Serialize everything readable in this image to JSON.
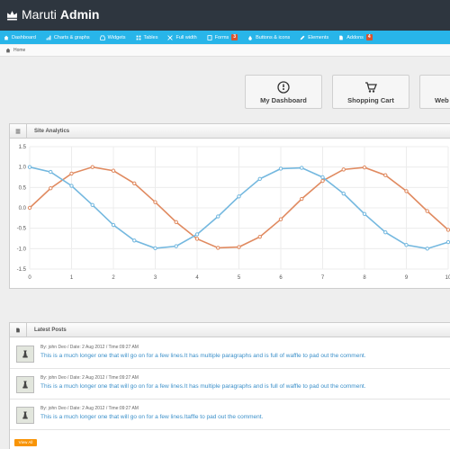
{
  "header": {
    "brand_light": "Maruti",
    "brand_bold": "Admin"
  },
  "nav": [
    {
      "label": "Dashboard",
      "icon": "home-icon"
    },
    {
      "label": "Charts & graphs",
      "icon": "signal-icon"
    },
    {
      "label": "Widgets",
      "icon": "inbox-icon"
    },
    {
      "label": "Tables",
      "icon": "th-icon"
    },
    {
      "label": "Full width",
      "icon": "fullscreen-icon"
    },
    {
      "label": "Forms",
      "icon": "forms-icon",
      "badge": "3"
    },
    {
      "label": "Buttons & icons",
      "icon": "tint-icon"
    },
    {
      "label": "Elements",
      "icon": "pencil-icon"
    },
    {
      "label": "Addons",
      "icon": "file-icon",
      "badge": "4"
    }
  ],
  "breadcrumb": {
    "home": "Home"
  },
  "quick_actions": [
    {
      "label": "My Dashboard",
      "icon": "dashboard-icon"
    },
    {
      "label": "Shopping Cart",
      "icon": "cart-icon"
    },
    {
      "label": "Web",
      "icon": "web-icon"
    }
  ],
  "analytics": {
    "title": "Site Analytics",
    "chart_data": {
      "type": "line",
      "xlim": [
        0,
        10
      ],
      "ylim": [
        -1.5,
        1.5
      ],
      "x_ticks": [
        "0",
        "1",
        "2",
        "3",
        "4",
        "5",
        "6",
        "7",
        "8",
        "9",
        "10"
      ],
      "y_ticks": [
        "1.5",
        "1.0",
        "0.5",
        "0.0",
        "-0.5",
        "-1.0",
        "-1.5"
      ],
      "grid": true,
      "x": [
        0,
        0.5,
        1,
        1.5,
        2,
        2.5,
        3,
        3.5,
        4,
        4.5,
        5,
        5.5,
        6,
        6.5,
        7,
        7.5,
        8,
        8.5,
        9,
        9.5,
        10
      ],
      "series": [
        {
          "color": "#e08a60",
          "values": [
            0.0,
            0.48,
            0.84,
            1.0,
            0.91,
            0.6,
            0.14,
            -0.35,
            -0.76,
            -0.98,
            -0.96,
            -0.71,
            -0.28,
            0.22,
            0.66,
            0.94,
            0.99,
            0.8,
            0.41,
            -0.08,
            -0.54
          ]
        },
        {
          "color": "#74b8df",
          "values": [
            1.0,
            0.88,
            0.54,
            0.07,
            -0.42,
            -0.8,
            -0.99,
            -0.94,
            -0.65,
            -0.21,
            0.28,
            0.71,
            0.96,
            0.98,
            0.75,
            0.35,
            -0.15,
            -0.6,
            -0.91,
            -1.0,
            -0.84
          ]
        }
      ]
    }
  },
  "latest_posts": {
    "title": "Latest Posts",
    "posts": [
      {
        "meta": "By: john Deo / Date: 2 Aug 2012 / Time:09:27 AM",
        "text": "This is a much longer one that will go on for a few lines.It has multiple paragraphs and is full of waffle to pad out the comment."
      },
      {
        "meta": "By: john Deo / Date: 2 Aug 2012 / Time:09:27 AM",
        "text": "This is a much longer one that will go on for a few lines.It has multiple paragraphs and is full of waffle to pad out the comment."
      },
      {
        "meta": "By: john Deo / Date: 2 Aug 2012 / Time:09:27 AM",
        "text": "This is a much longer one that will go on for a few lines.Itaffle to pad out the comment."
      }
    ],
    "view_all": "View All"
  }
}
